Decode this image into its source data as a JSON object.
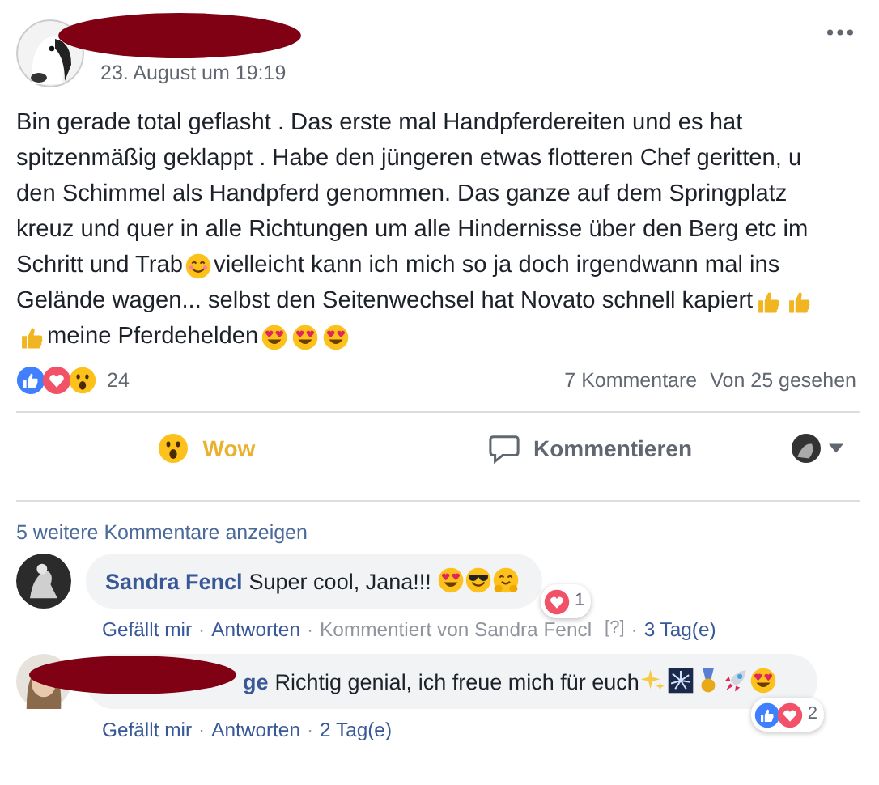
{
  "post": {
    "author_redacted": true,
    "date": "23. August um 19:19",
    "lines": [
      [
        {
          "kind": "text",
          "text": "Bin gerade total geflasht . Das erste mal Handpferdereiten und es hat"
        }
      ],
      [
        {
          "kind": "text",
          "text": "spitzenmäßig geklappt . Habe den jüngeren etwas flotteren Chef geritten, u"
        }
      ],
      [
        {
          "kind": "text",
          "text": "den Schimmel als Handpferd genommen. Das ganze auf dem Springplatz"
        }
      ],
      [
        {
          "kind": "text",
          "text": "kreuz und quer in alle Richtungen um alle Hindernisse über den Berg etc im"
        }
      ],
      [
        {
          "kind": "text",
          "text": "Schritt und Trab"
        },
        {
          "kind": "smile"
        },
        {
          "kind": "text",
          "text": " vielleicht kann ich mich so ja doch irgendwann mal ins"
        }
      ],
      [
        {
          "kind": "text",
          "text": "Gelände wagen... selbst den Seitenwechsel hat Novato schnell kapiert "
        },
        {
          "kind": "thumbs-up"
        },
        {
          "kind": "thumbs-up"
        }
      ],
      [
        {
          "kind": "thumbs-up"
        },
        {
          "kind": "text",
          "text": "meine Pferdehelden"
        },
        {
          "kind": "heart-eyes"
        },
        {
          "kind": "heart-eyes"
        },
        {
          "kind": "heart-eyes"
        }
      ]
    ],
    "reactions": [
      {
        "kind": "like"
      },
      {
        "kind": "love"
      },
      {
        "kind": "wow"
      }
    ],
    "reaction_count": "24",
    "comments_count": "7 Kommentare",
    "seen": "Von 25 gesehen"
  },
  "actions": [
    {
      "kind": "wow",
      "label": "Wow",
      "selected": true
    },
    {
      "kind": "comment",
      "label": "Kommentieren",
      "selected": false
    }
  ],
  "more_comments": "5 weitere Kommentare anzeigen",
  "comments": [
    {
      "author": "Sandra Fencl",
      "redacted": false,
      "body": [
        {
          "kind": "text",
          "text": "Super cool, Jana!!! "
        },
        {
          "kind": "heart-eyes"
        },
        {
          "kind": "cool"
        },
        {
          "kind": "hug"
        }
      ],
      "reactions": [
        {
          "kind": "love"
        }
      ],
      "reaction_count": "1",
      "separator": "·",
      "links": [
        "Gefällt mir",
        "Antworten"
      ],
      "note": "Kommentiert von Sandra Fencl",
      "help": "[?]",
      "age": "3 Tag(e)"
    },
    {
      "author": "ge",
      "redacted": true,
      "body": [
        {
          "kind": "text",
          "text": "Richtig genial, ich freue mich für euch"
        },
        {
          "kind": "sparkles"
        },
        {
          "kind": "fireworks"
        },
        {
          "kind": "medal"
        },
        {
          "kind": "rocket"
        },
        {
          "kind": "heart-eyes"
        }
      ],
      "reactions": [
        {
          "kind": "like"
        },
        {
          "kind": "love"
        }
      ],
      "reaction_count": "2",
      "separator": "·",
      "links": [
        "Gefällt mir",
        "Antworten"
      ],
      "age": "2 Tag(e)"
    }
  ]
}
